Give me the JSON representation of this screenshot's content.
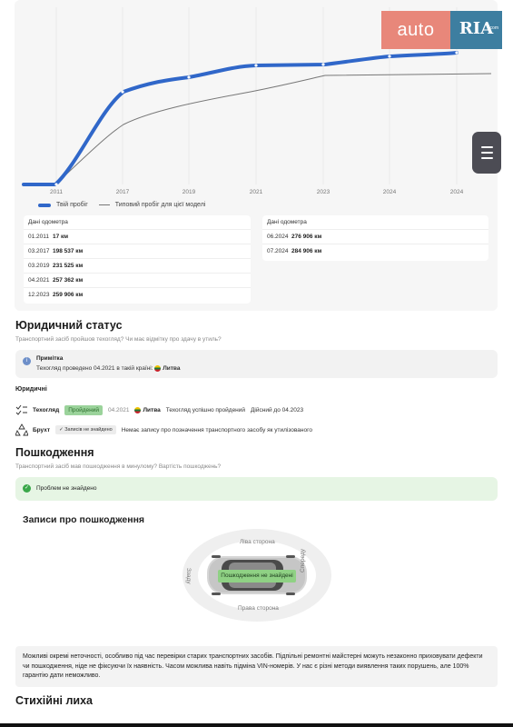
{
  "logo": {
    "auto": "auto",
    "ria": "RIA",
    "domain": ".com"
  },
  "chart": {
    "x_ticks": [
      "2011",
      "2017",
      "2019",
      "2021",
      "2023",
      "2024",
      "2024"
    ],
    "legend": {
      "yours": "Твій пробіг",
      "typical": "Типовий пробіг для цієї моделі"
    },
    "colors": {
      "yours": "#3067c9",
      "typical": "#777777"
    }
  },
  "odometer": {
    "left": {
      "header": "Дані одометра",
      "rows": [
        {
          "date": "01.2011",
          "value": "17 км"
        },
        {
          "date": "03.2017",
          "value": "198 537 км"
        },
        {
          "date": "03.2019",
          "value": "231 525 км"
        },
        {
          "date": "04.2021",
          "value": "257 362 км"
        },
        {
          "date": "12.2023",
          "value": "259 906 км"
        }
      ]
    },
    "right": {
      "header": "Дані одометра",
      "rows": [
        {
          "date": "06.2024",
          "value": "276 906 км"
        },
        {
          "date": "07.2024",
          "value": "284 906 км"
        }
      ]
    }
  },
  "legal": {
    "title": "Юридичний статус",
    "subtitle": "Транспортний засіб пройшов техогляд? Чи має відмітку про здачу в утиль?",
    "note": {
      "title": "Примітка",
      "text": "Техогляд проведено 04.2021 в такій країні:",
      "country": "Литва"
    },
    "section_label": "Юридичні",
    "inspection": {
      "label": "Техогляд",
      "badge": "Пройдений",
      "date": "04.2021",
      "country": "Литва",
      "text": "Техогляд успішно пройдений",
      "valid": "Дійсний до 04.2023"
    },
    "scrap": {
      "label": "Брухт",
      "badge": "✓ Записів не знайдено",
      "text": "Немає запису про позначення транспортного засобу як утилізованого"
    }
  },
  "damage": {
    "title": "Пошкодження",
    "subtitle": "Транспортний засіб мав пошкодження в минулому? Вартість пошкоджень?",
    "ok_text": "Проблем не знайдено",
    "records_title": "Записи про пошкодження",
    "sides": {
      "left": "Ліва сторона",
      "right": "Права сторона",
      "front": "Спереду",
      "rear": "Ззаду"
    },
    "badge": "Пошкодження не знайдені",
    "disclaimer": "Можливі окремі неточності, особливо під час перевірки старих транспортних засобів. Підпільні ремонтні майстерні можуть незаконно приховувати дефекти чи пошкодження, ніде не фіксуючи їх наявність. Часом можлива навіть підміна VIN-номерів. У нас є різні методи виявлення таких порушень, але 100% гарантію дати неможливо."
  },
  "disasters": {
    "title": "Стихійні лиха"
  }
}
